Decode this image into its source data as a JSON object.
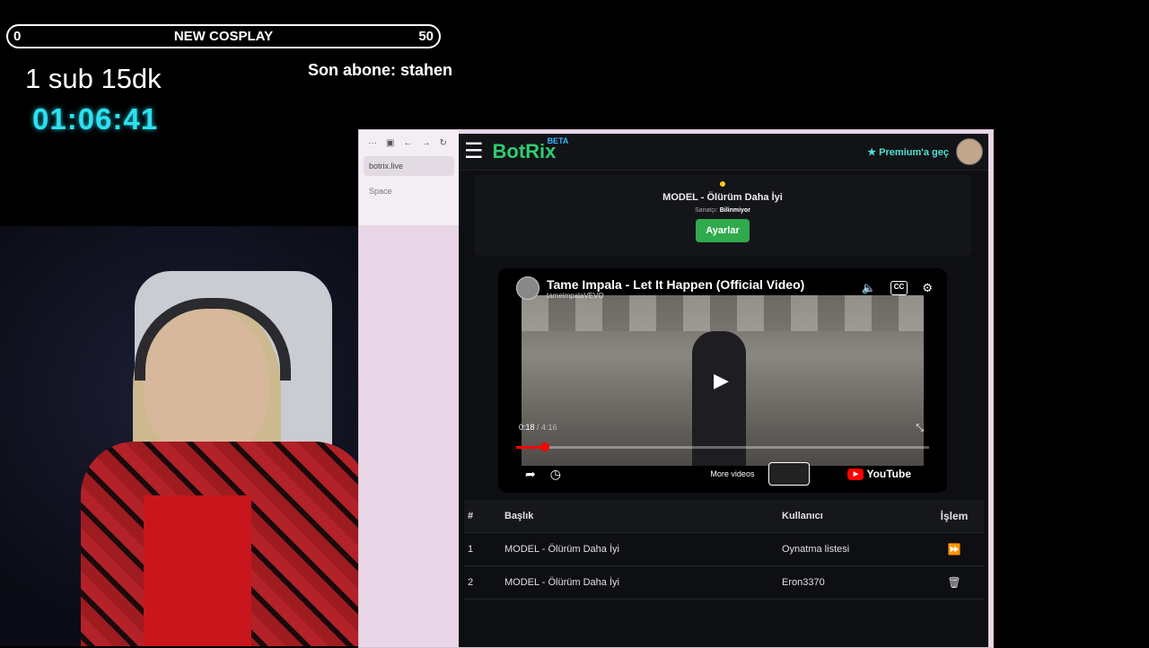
{
  "overlay": {
    "goal_min": "0",
    "goal_title": "NEW COSPLAY",
    "goal_max": "50",
    "sub_text": "1 sub 15dk",
    "timer": "01:06:41",
    "last_sub": "Son abone: stahen",
    "timer_color": "#2ee0ee"
  },
  "browser": {
    "sidebar_icons": [
      "···",
      "▣",
      "←",
      "→",
      "↻"
    ],
    "tab_label": "botrix.live",
    "space_label": "Space"
  },
  "app": {
    "logo": "BotRix",
    "beta": "BETA",
    "premium_label": "Premium'a geç",
    "now_playing": {
      "title": "MODEL - Ölürüm Daha İyi",
      "artist_label": "Sanatçı:",
      "artist": "Bilinmiyor",
      "settings_button": "Ayarlar"
    },
    "youtube": {
      "title": "Tame Impala - Let It Happen (Official Video)",
      "channel": "tameimpalaVEVO",
      "current_time": "0:18",
      "duration": "/ 4:16",
      "progress": 0.07,
      "more_videos": "More videos",
      "logo_text": "YouTube",
      "cc_label": "CC"
    },
    "queue": {
      "headers": [
        "#",
        "Başlık",
        "Kullanıcı",
        "İşlem"
      ],
      "rows": [
        {
          "num": "1",
          "title": "MODEL - Ölürüm Daha İyi",
          "user": "Oynatma listesi",
          "action_icon": "skip-icon"
        },
        {
          "num": "2",
          "title": "MODEL - Ölürüm Daha İyi",
          "user": "Eron3370",
          "action_icon": "trash-icon"
        }
      ]
    },
    "accent_green": "#2ecc71"
  }
}
